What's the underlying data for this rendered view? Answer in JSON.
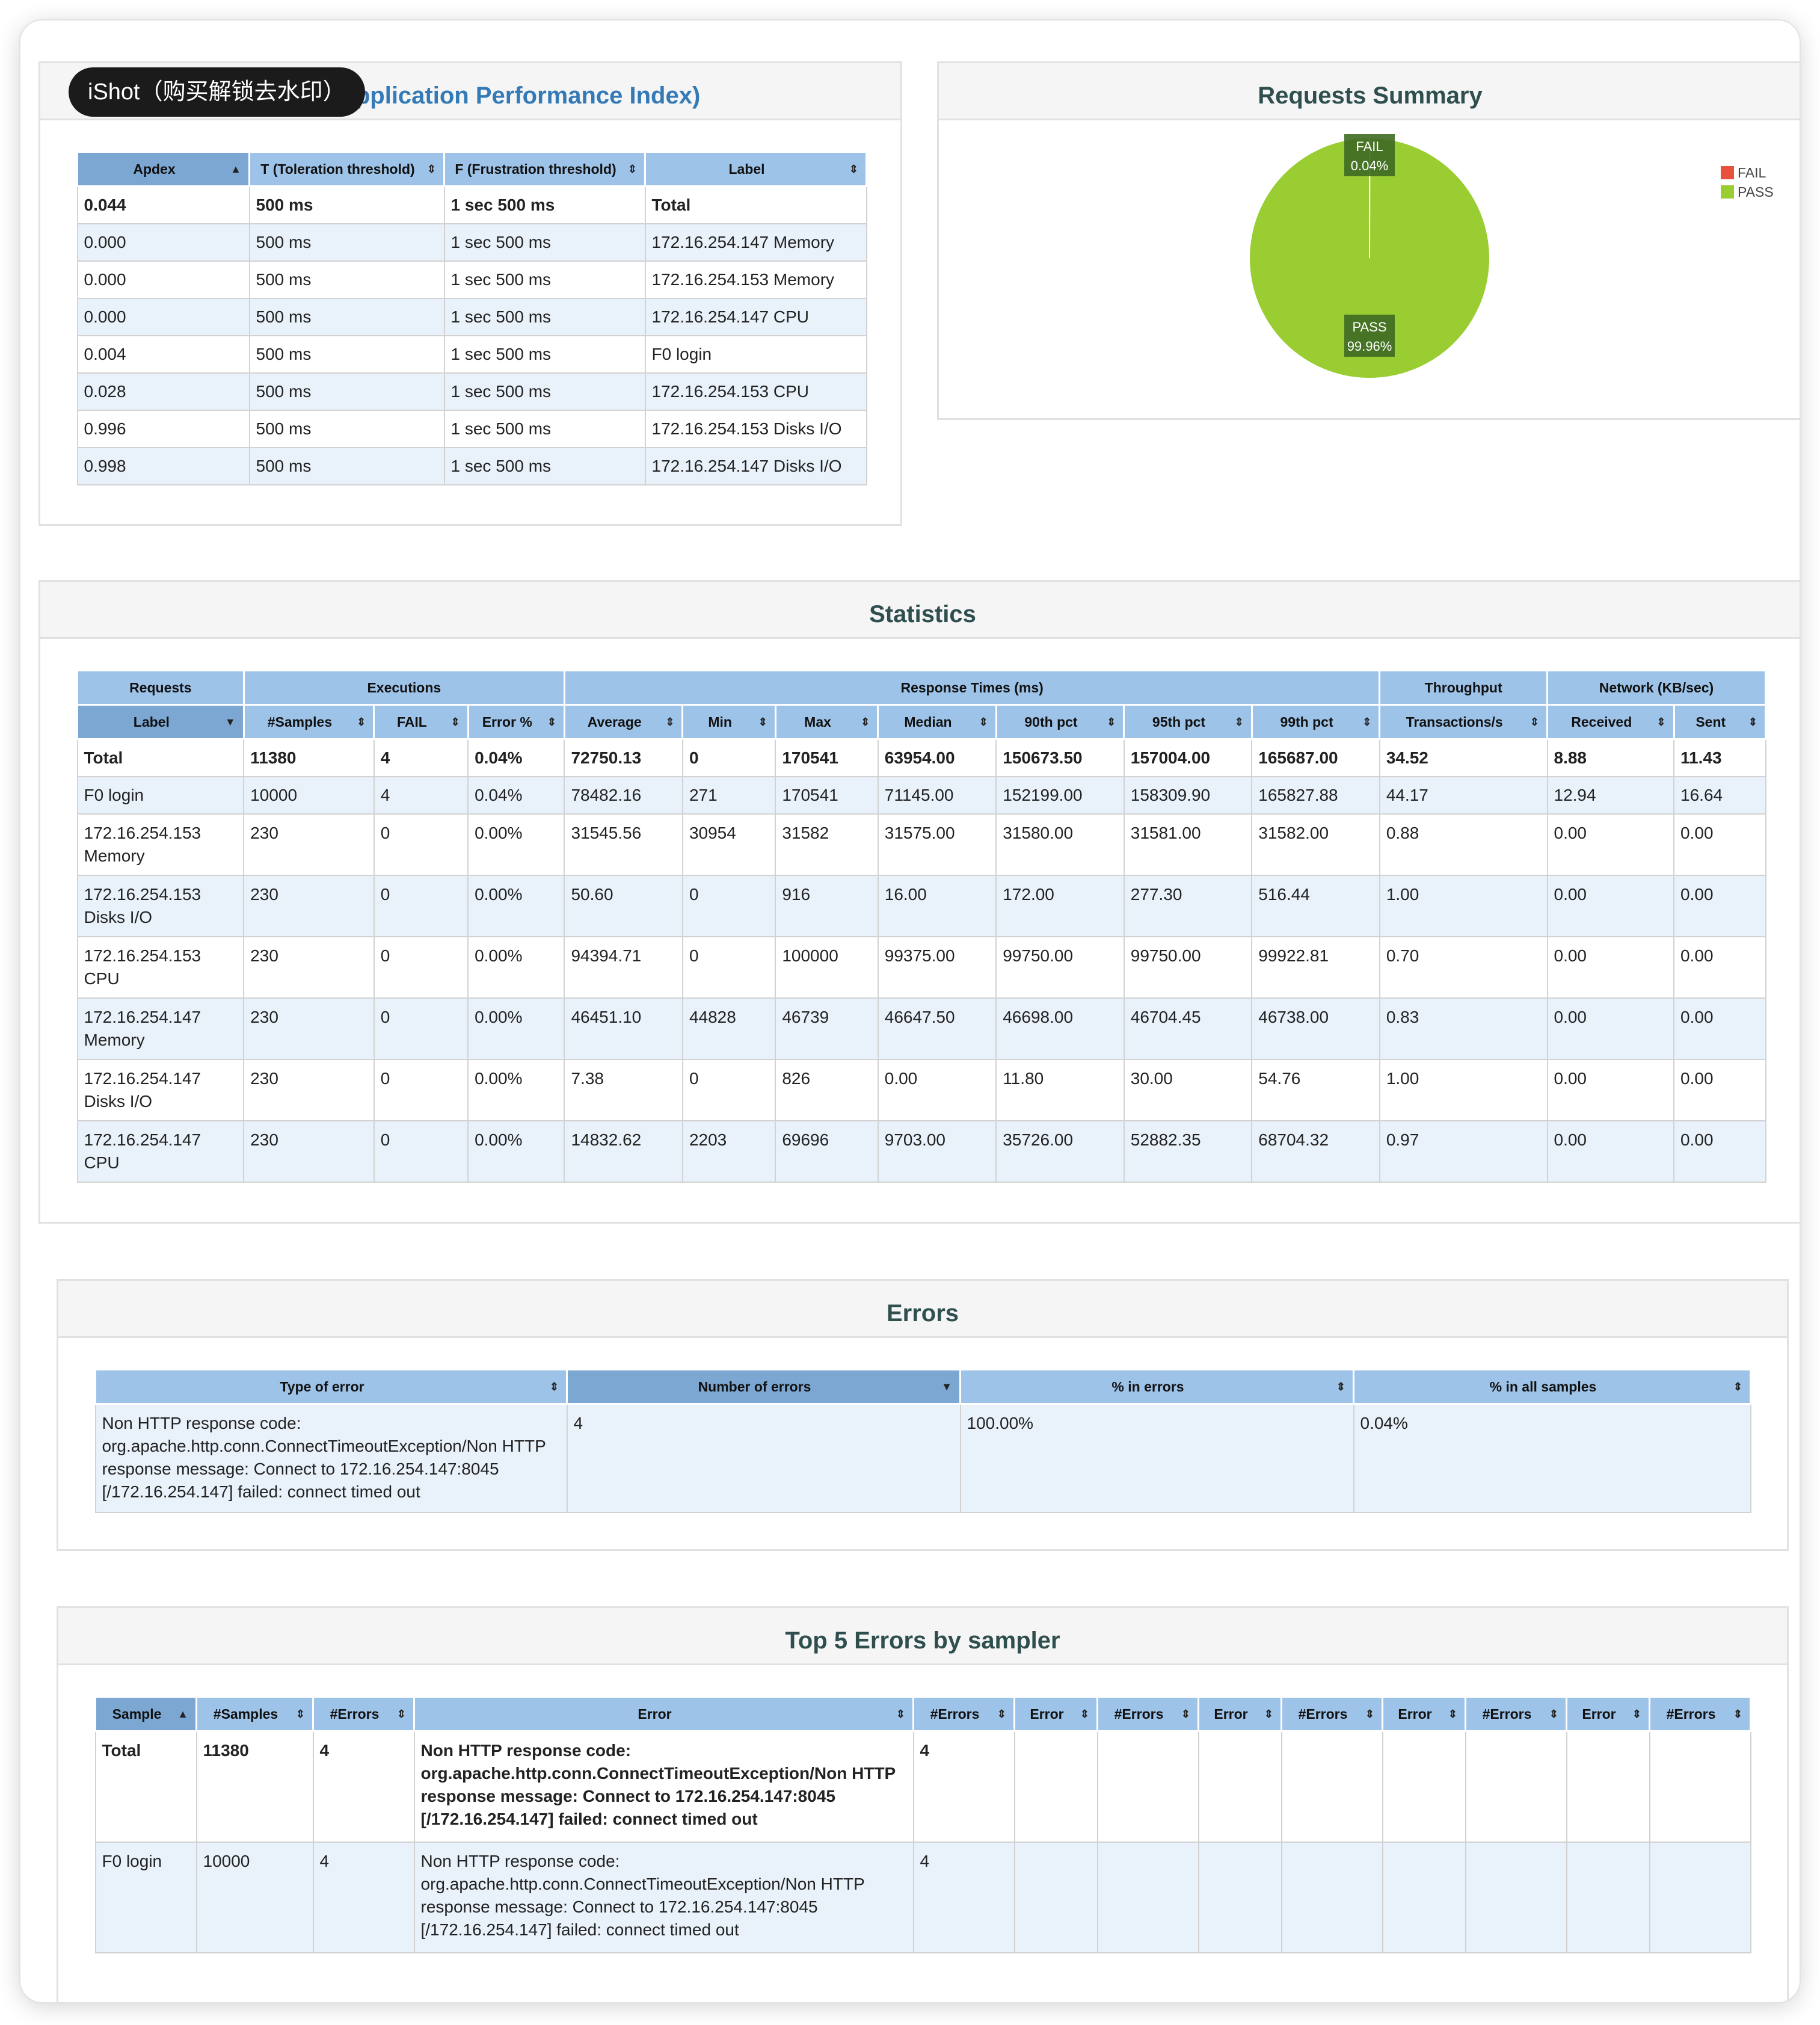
{
  "watermark": "iShot（购买解锁去水印）",
  "apdex": {
    "title": "APDEX (Application Performance Index)",
    "headers": [
      "Apdex",
      "T (Toleration threshold)",
      "F (Frustration threshold)",
      "Label"
    ],
    "rows": [
      [
        "0.044",
        "500 ms",
        "1 sec 500 ms",
        "Total"
      ],
      [
        "0.000",
        "500 ms",
        "1 sec 500 ms",
        "172.16.254.147 Memory"
      ],
      [
        "0.000",
        "500 ms",
        "1 sec 500 ms",
        "172.16.254.153 Memory"
      ],
      [
        "0.000",
        "500 ms",
        "1 sec 500 ms",
        "172.16.254.147 CPU"
      ],
      [
        "0.004",
        "500 ms",
        "1 sec 500 ms",
        "F0 login"
      ],
      [
        "0.028",
        "500 ms",
        "1 sec 500 ms",
        "172.16.254.153 CPU"
      ],
      [
        "0.996",
        "500 ms",
        "1 sec 500 ms",
        "172.16.254.153 Disks I/O"
      ],
      [
        "0.998",
        "500 ms",
        "1 sec 500 ms",
        "172.16.254.147 Disks I/O"
      ]
    ]
  },
  "summary": {
    "title": "Requests Summary",
    "legend": [
      {
        "label": "FAIL",
        "color": "#e8513c"
      },
      {
        "label": "PASS",
        "color": "#9acd32"
      }
    ],
    "fail_label": "FAIL",
    "fail_pct": "0.04%",
    "pass_label": "PASS",
    "pass_pct": "99.96%"
  },
  "chart_data": {
    "type": "pie",
    "title": "Requests Summary",
    "categories": [
      "FAIL",
      "PASS"
    ],
    "values": [
      0.04,
      99.96
    ],
    "colors": [
      "#e8513c",
      "#9acd32"
    ],
    "legend_position": "top-right"
  },
  "statistics": {
    "title": "Statistics",
    "groups": [
      "Requests",
      "Executions",
      "Response Times (ms)",
      "Throughput",
      "Network (KB/sec)"
    ],
    "headers": [
      "Label",
      "#Samples",
      "FAIL",
      "Error %",
      "Average",
      "Min",
      "Max",
      "Median",
      "90th pct",
      "95th pct",
      "99th pct",
      "Transactions/s",
      "Received",
      "Sent"
    ],
    "rows": [
      [
        "Total",
        "11380",
        "4",
        "0.04%",
        "72750.13",
        "0",
        "170541",
        "63954.00",
        "150673.50",
        "157004.00",
        "165687.00",
        "34.52",
        "8.88",
        "11.43"
      ],
      [
        "F0 login",
        "10000",
        "4",
        "0.04%",
        "78482.16",
        "271",
        "170541",
        "71145.00",
        "152199.00",
        "158309.90",
        "165827.88",
        "44.17",
        "12.94",
        "16.64"
      ],
      [
        "172.16.254.153 Memory",
        "230",
        "0",
        "0.00%",
        "31545.56",
        "30954",
        "31582",
        "31575.00",
        "31580.00",
        "31581.00",
        "31582.00",
        "0.88",
        "0.00",
        "0.00"
      ],
      [
        "172.16.254.153 Disks I/O",
        "230",
        "0",
        "0.00%",
        "50.60",
        "0",
        "916",
        "16.00",
        "172.00",
        "277.30",
        "516.44",
        "1.00",
        "0.00",
        "0.00"
      ],
      [
        "172.16.254.153 CPU",
        "230",
        "0",
        "0.00%",
        "94394.71",
        "0",
        "100000",
        "99375.00",
        "99750.00",
        "99750.00",
        "99922.81",
        "0.70",
        "0.00",
        "0.00"
      ],
      [
        "172.16.254.147 Memory",
        "230",
        "0",
        "0.00%",
        "46451.10",
        "44828",
        "46739",
        "46647.50",
        "46698.00",
        "46704.45",
        "46738.00",
        "0.83",
        "0.00",
        "0.00"
      ],
      [
        "172.16.254.147 Disks I/O",
        "230",
        "0",
        "0.00%",
        "7.38",
        "0",
        "826",
        "0.00",
        "11.80",
        "30.00",
        "54.76",
        "1.00",
        "0.00",
        "0.00"
      ],
      [
        "172.16.254.147 CPU",
        "230",
        "0",
        "0.00%",
        "14832.62",
        "2203",
        "69696",
        "9703.00",
        "35726.00",
        "52882.35",
        "68704.32",
        "0.97",
        "0.00",
        "0.00"
      ]
    ]
  },
  "errors": {
    "title": "Errors",
    "headers": [
      "Type of error",
      "Number of errors",
      "% in errors",
      "% in all samples"
    ],
    "rows": [
      [
        "Non HTTP response code: org.apache.http.conn.ConnectTimeoutException/Non HTTP response message: Connect to 172.16.254.147:8045 [/172.16.254.147] failed: connect timed out",
        "4",
        "100.00%",
        "0.04%"
      ]
    ]
  },
  "top5": {
    "title": "Top 5 Errors by sampler",
    "headers": [
      "Sample",
      "#Samples",
      "#Errors",
      "Error",
      "#Errors",
      "Error",
      "#Errors",
      "Error",
      "#Errors",
      "Error",
      "#Errors",
      "Error",
      "#Errors"
    ],
    "rows": [
      [
        "Total",
        "11380",
        "4",
        "Non HTTP response code: org.apache.http.conn.ConnectTimeoutException/Non HTTP response message: Connect to 172.16.254.147:8045 [/172.16.254.147] failed: connect timed out",
        "4",
        "",
        "",
        "",
        "",
        "",
        "",
        "",
        ""
      ],
      [
        "F0 login",
        "10000",
        "4",
        "Non HTTP response code: org.apache.http.conn.ConnectTimeoutException/Non HTTP response message: Connect to 172.16.254.147:8045 [/172.16.254.147] failed: connect timed out",
        "4",
        "",
        "",
        "",
        "",
        "",
        "",
        "",
        ""
      ]
    ]
  }
}
